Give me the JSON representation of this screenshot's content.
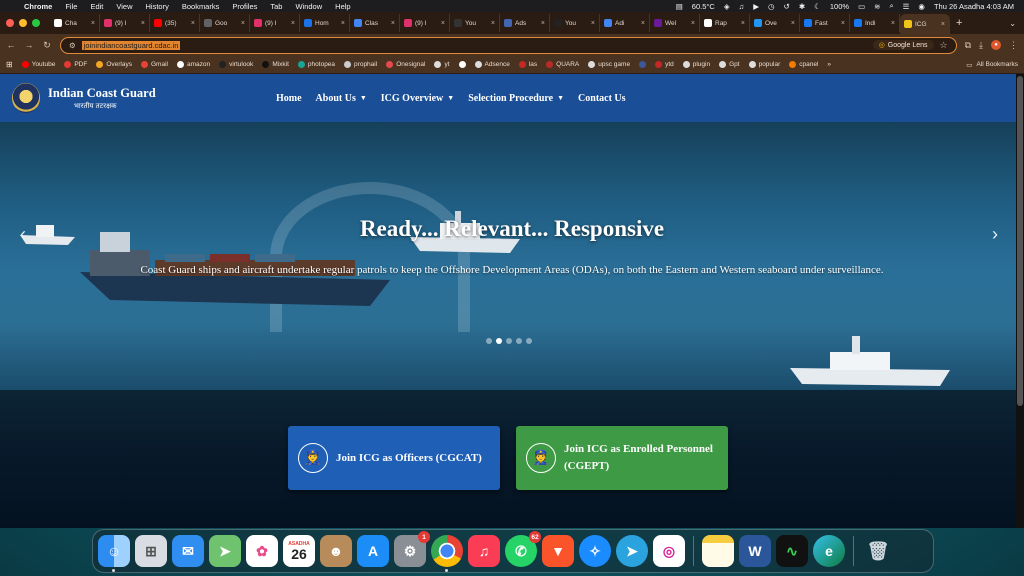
{
  "menubar": {
    "app_name": "Chrome",
    "menus": [
      "File",
      "Edit",
      "View",
      "History",
      "Bookmarks",
      "Profiles",
      "Tab",
      "Window",
      "Help"
    ],
    "temperature": "60.5°C",
    "battery": "100%",
    "datetime": "Thu 26 Asadha  4:03 AM"
  },
  "tabs": [
    {
      "title": "Cha",
      "color": "#ffffff"
    },
    {
      "title": "(9) I",
      "color": "#e1306c"
    },
    {
      "title": "(35)",
      "color": "#ff0000"
    },
    {
      "title": "Goo",
      "color": "#5f6368"
    },
    {
      "title": "(9) I",
      "color": "#e1306c"
    },
    {
      "title": "Hom",
      "color": "#1a73e8"
    },
    {
      "title": "Clas",
      "color": "#4285f4"
    },
    {
      "title": "(9) I",
      "color": "#e1306c"
    },
    {
      "title": "You",
      "color": "#333333"
    },
    {
      "title": "Ads",
      "color": "#4267b2"
    },
    {
      "title": "You",
      "color": "#222222"
    },
    {
      "title": "Adi",
      "color": "#4285f4"
    },
    {
      "title": "Wel",
      "color": "#6a1b9a"
    },
    {
      "title": "Rap",
      "color": "#ffffff"
    },
    {
      "title": "Ove",
      "color": "#2196f3"
    },
    {
      "title": "Fast",
      "color": "#1877f2"
    },
    {
      "title": "Indi",
      "color": "#1877f2"
    },
    {
      "title": "ICG",
      "color": "#f0c419"
    }
  ],
  "toolbar": {
    "url": "joinindiancoastguard.cdac.in",
    "lens_label": "Google Lens"
  },
  "bookmarks": [
    {
      "label": "Youtube",
      "color": "#ff0000"
    },
    {
      "label": "PDF",
      "color": "#e53935"
    },
    {
      "label": "Overlays",
      "color": "#f5a623"
    },
    {
      "label": "Gmail",
      "color": "#ea4335"
    },
    {
      "label": "amazon",
      "color": "#ffffff"
    },
    {
      "label": "virtulook",
      "color": "#222222"
    },
    {
      "label": "Mixkit",
      "color": "#111111"
    },
    {
      "label": "photopea",
      "color": "#18a497"
    },
    {
      "label": "prophail",
      "color": "#cccccc"
    },
    {
      "label": "Onesignal",
      "color": "#e54b4d"
    },
    {
      "label": "yt",
      "color": "#dddddd"
    },
    {
      "label": "",
      "color": "#ffffff"
    },
    {
      "label": "Adsence",
      "color": "#dddddd"
    },
    {
      "label": "las",
      "color": "#c62828"
    },
    {
      "label": "QUARA",
      "color": "#b92b27"
    },
    {
      "label": "upsc game",
      "color": "#dddddd"
    },
    {
      "label": "",
      "color": "#3b5998"
    },
    {
      "label": "ytd",
      "color": "#c62828"
    },
    {
      "label": "plugin",
      "color": "#dddddd"
    },
    {
      "label": "Gpt",
      "color": "#dddddd"
    },
    {
      "label": "popular",
      "color": "#dddddd"
    },
    {
      "label": "cpanel",
      "color": "#f57c00"
    }
  ],
  "all_bookmarks_label": "All Bookmarks",
  "site": {
    "brand_en": "Indian Coast Guard",
    "brand_hi": "भारतीय तटरक्षक",
    "nav": [
      {
        "label": "Home",
        "dropdown": false
      },
      {
        "label": "About Us",
        "dropdown": true
      },
      {
        "label": "ICG Overview",
        "dropdown": true
      },
      {
        "label": "Selection Procedure",
        "dropdown": true
      },
      {
        "label": "Contact Us",
        "dropdown": false
      }
    ],
    "hero_title": "Ready... Relevant... Responsive",
    "hero_subtitle": "Coast Guard ships and aircraft undertake regular patrols to keep the Offshore Development Areas (ODAs), on both the Eastern and Western seaboard under surveillance.",
    "carousel_dots": 5,
    "carousel_active": 2,
    "cta_officers": "Join ICG as Officers (CGCAT)",
    "cta_enrolled": "Join ICG as Enrolled Personnel (CGEPT)"
  },
  "dock": {
    "calendar_month": "ASADHA",
    "calendar_day": "26",
    "settings_badge": "1",
    "whatsapp_badge": "62"
  }
}
